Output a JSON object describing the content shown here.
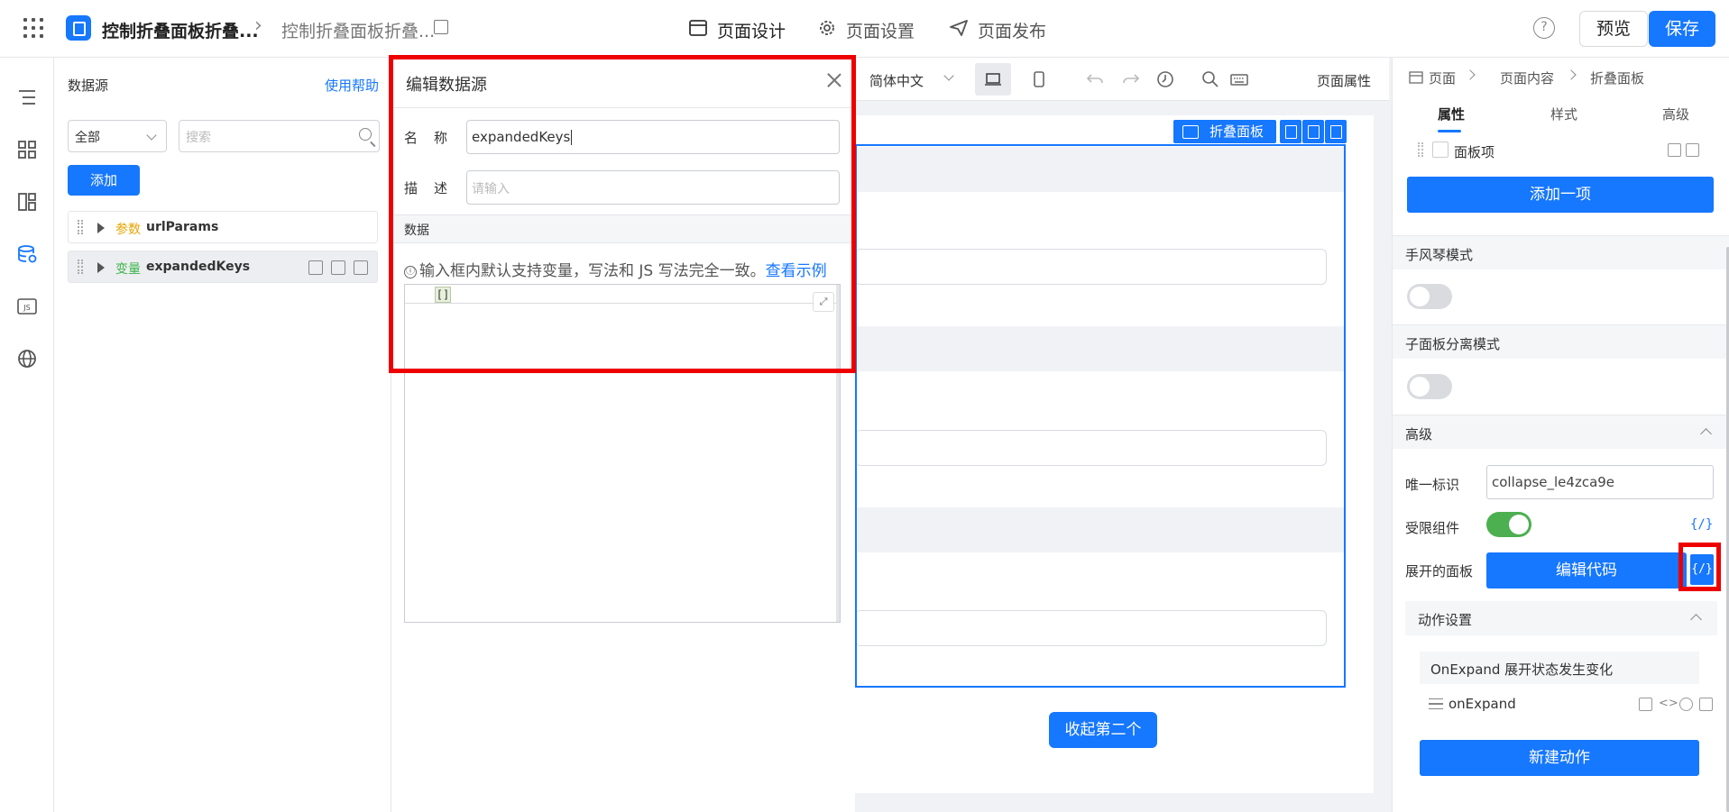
{
  "header": {
    "app_title": "控制折叠面板折叠...",
    "page_title": "控制折叠面板折叠...",
    "tabs": [
      {
        "label": "页面设计",
        "active": true
      },
      {
        "label": "页面设置",
        "active": false
      },
      {
        "label": "页面发布",
        "active": false
      }
    ],
    "help_label": "?",
    "preview_label": "预览",
    "save_label": "保存"
  },
  "rail": {
    "icons": [
      "outline-icon",
      "components-icon",
      "templates-icon",
      "datasource-icon",
      "js-icon",
      "globe-icon"
    ]
  },
  "datasource": {
    "title": "数据源",
    "help_link": "使用帮助",
    "filter_value": "全部",
    "search_placeholder": "搜索",
    "add_label": "添加",
    "items": [
      {
        "type": "参数",
        "type_color": "#e8a400",
        "name": "urlParams",
        "selected": false
      },
      {
        "type": "变量",
        "type_color": "#3bb54a",
        "name": "expandedKeys",
        "selected": true
      }
    ]
  },
  "dialog": {
    "title": "编辑数据源",
    "name_label": "名称",
    "name_value": "expandedKeys",
    "desc_label": "描述",
    "desc_placeholder": "请输入",
    "data_section": "数据",
    "tip_icon": "ⓘ",
    "tip_text": "输入框内默认支持变量，写法和 JS 写法完全一致。",
    "tip_link": "查看示例",
    "code_value": "[]",
    "expand_glyph": "⤢"
  },
  "canvas_toolbar": {
    "language": "简体中文",
    "page_attr_label": "页面属性"
  },
  "canvas": {
    "component_tag": "折叠面板",
    "collapse_button": "收起第二个"
  },
  "properties": {
    "breadcrumb": [
      "页面",
      "页面内容",
      "折叠面板"
    ],
    "tabs": [
      {
        "label": "属性",
        "active": true
      },
      {
        "label": "样式",
        "active": false
      },
      {
        "label": "高级",
        "active": false
      }
    ],
    "panel_item_label": "面板项",
    "add_item_label": "添加一项",
    "accordion_label": "手风琴模式",
    "accordion_on": false,
    "separate_label": "子面板分离模式",
    "separate_on": false,
    "advanced_label": "高级",
    "uid_label": "唯一标识",
    "uid_value": "collapse_le4zca9e",
    "restricted_label": "受限组件",
    "restricted_on": true,
    "fx_glyph": "{/}",
    "expanded_label": "展开的面板",
    "edit_code_label": "编辑代码",
    "action_section": "动作设置",
    "event_title": "OnExpand 展开状态发生变化",
    "event_handler": "onExpand",
    "new_action_label": "新建动作"
  },
  "colors": {
    "primary": "#1677ff",
    "highlight": "#ee0000",
    "switch_on": "#4caf50"
  }
}
